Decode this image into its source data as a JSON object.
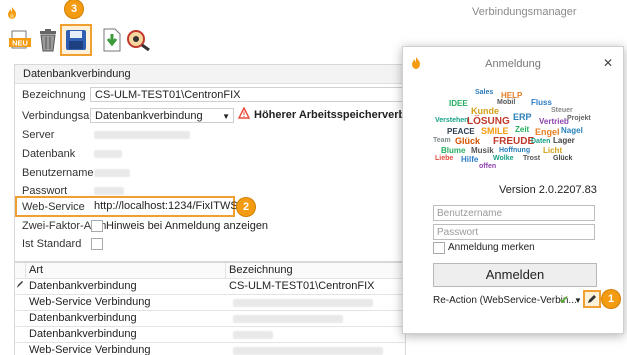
{
  "window": {
    "title": "Verbindungsmanager"
  },
  "toolbar": {
    "new_label": "NEU",
    "badge_3": "3"
  },
  "group": {
    "title": "Datenbankverbindung",
    "fields": {
      "bezeichnung": {
        "label": "Bezeichnung",
        "value": "CS-ULM-TEST01\\CentronFIX"
      },
      "verbindungsart": {
        "label": "Verbindungsart",
        "value": "Datenbankverbindung",
        "warning": "Höherer Arbeitsspeicherverbrauch, w"
      },
      "server": {
        "label": "Server"
      },
      "datenbank": {
        "label": "Datenbank"
      },
      "benutzername": {
        "label": "Benutzername"
      },
      "passwort": {
        "label": "Passwort"
      },
      "webservice": {
        "label": "Web-Service",
        "value": "http://localhost:1234/FixITWS",
        "badge": "2"
      },
      "zwei_faktor": {
        "label": "Zwei-Faktor-Auth",
        "checkbox_label": "Hinweis bei Anmeldung anzeigen"
      },
      "ist_standard": {
        "label": "Ist Standard"
      }
    }
  },
  "grid": {
    "columns": [
      "Art",
      "Bezeichnung"
    ],
    "rows": [
      {
        "art": "Datenbankverbindung",
        "bezeichnung": "CS-ULM-TEST01\\CentronFIX"
      },
      {
        "art": "Web-Service Verbindung",
        "bezeichnung": ""
      },
      {
        "art": "Datenbankverbindung",
        "bezeichnung": ""
      },
      {
        "art": "Datenbankverbindung",
        "bezeichnung": ""
      },
      {
        "art": "Web-Service Verbindung",
        "bezeichnung": ""
      }
    ]
  },
  "dialog": {
    "title": "Anmeldung",
    "close": "✕",
    "version": "Version 2.0.2207.83",
    "username_placeholder": "Benutzername",
    "password_placeholder": "Passwort",
    "remember": "Anmeldung merken",
    "login_button": "Anmelden",
    "connection_select": "Re-Action (WebService-Verbin...",
    "badge_1": "1",
    "wordcloud": [
      "Sales",
      "HELP",
      "IDEE",
      "Mobil",
      "Fluss",
      "Kunde",
      "Steuer",
      "Verstehen",
      "LÖSUNG",
      "ERP",
      "Vertrieb",
      "Projekt",
      "PEACE",
      "SMILE",
      "Zeit",
      "Engel",
      "Nagel",
      "Team",
      "Glück",
      "FREUDE",
      "Daten",
      "Lager",
      "Blume",
      "Musik",
      "Hoffnung",
      "Licht",
      "Liebe",
      "Hilfe",
      "Wolke",
      "Trost",
      "offen",
      "Glück"
    ]
  },
  "colors": {
    "accent": "#f39c12",
    "highlight": "#f0a030",
    "warning": "#e74c3c",
    "check_green": "#5aa832"
  }
}
